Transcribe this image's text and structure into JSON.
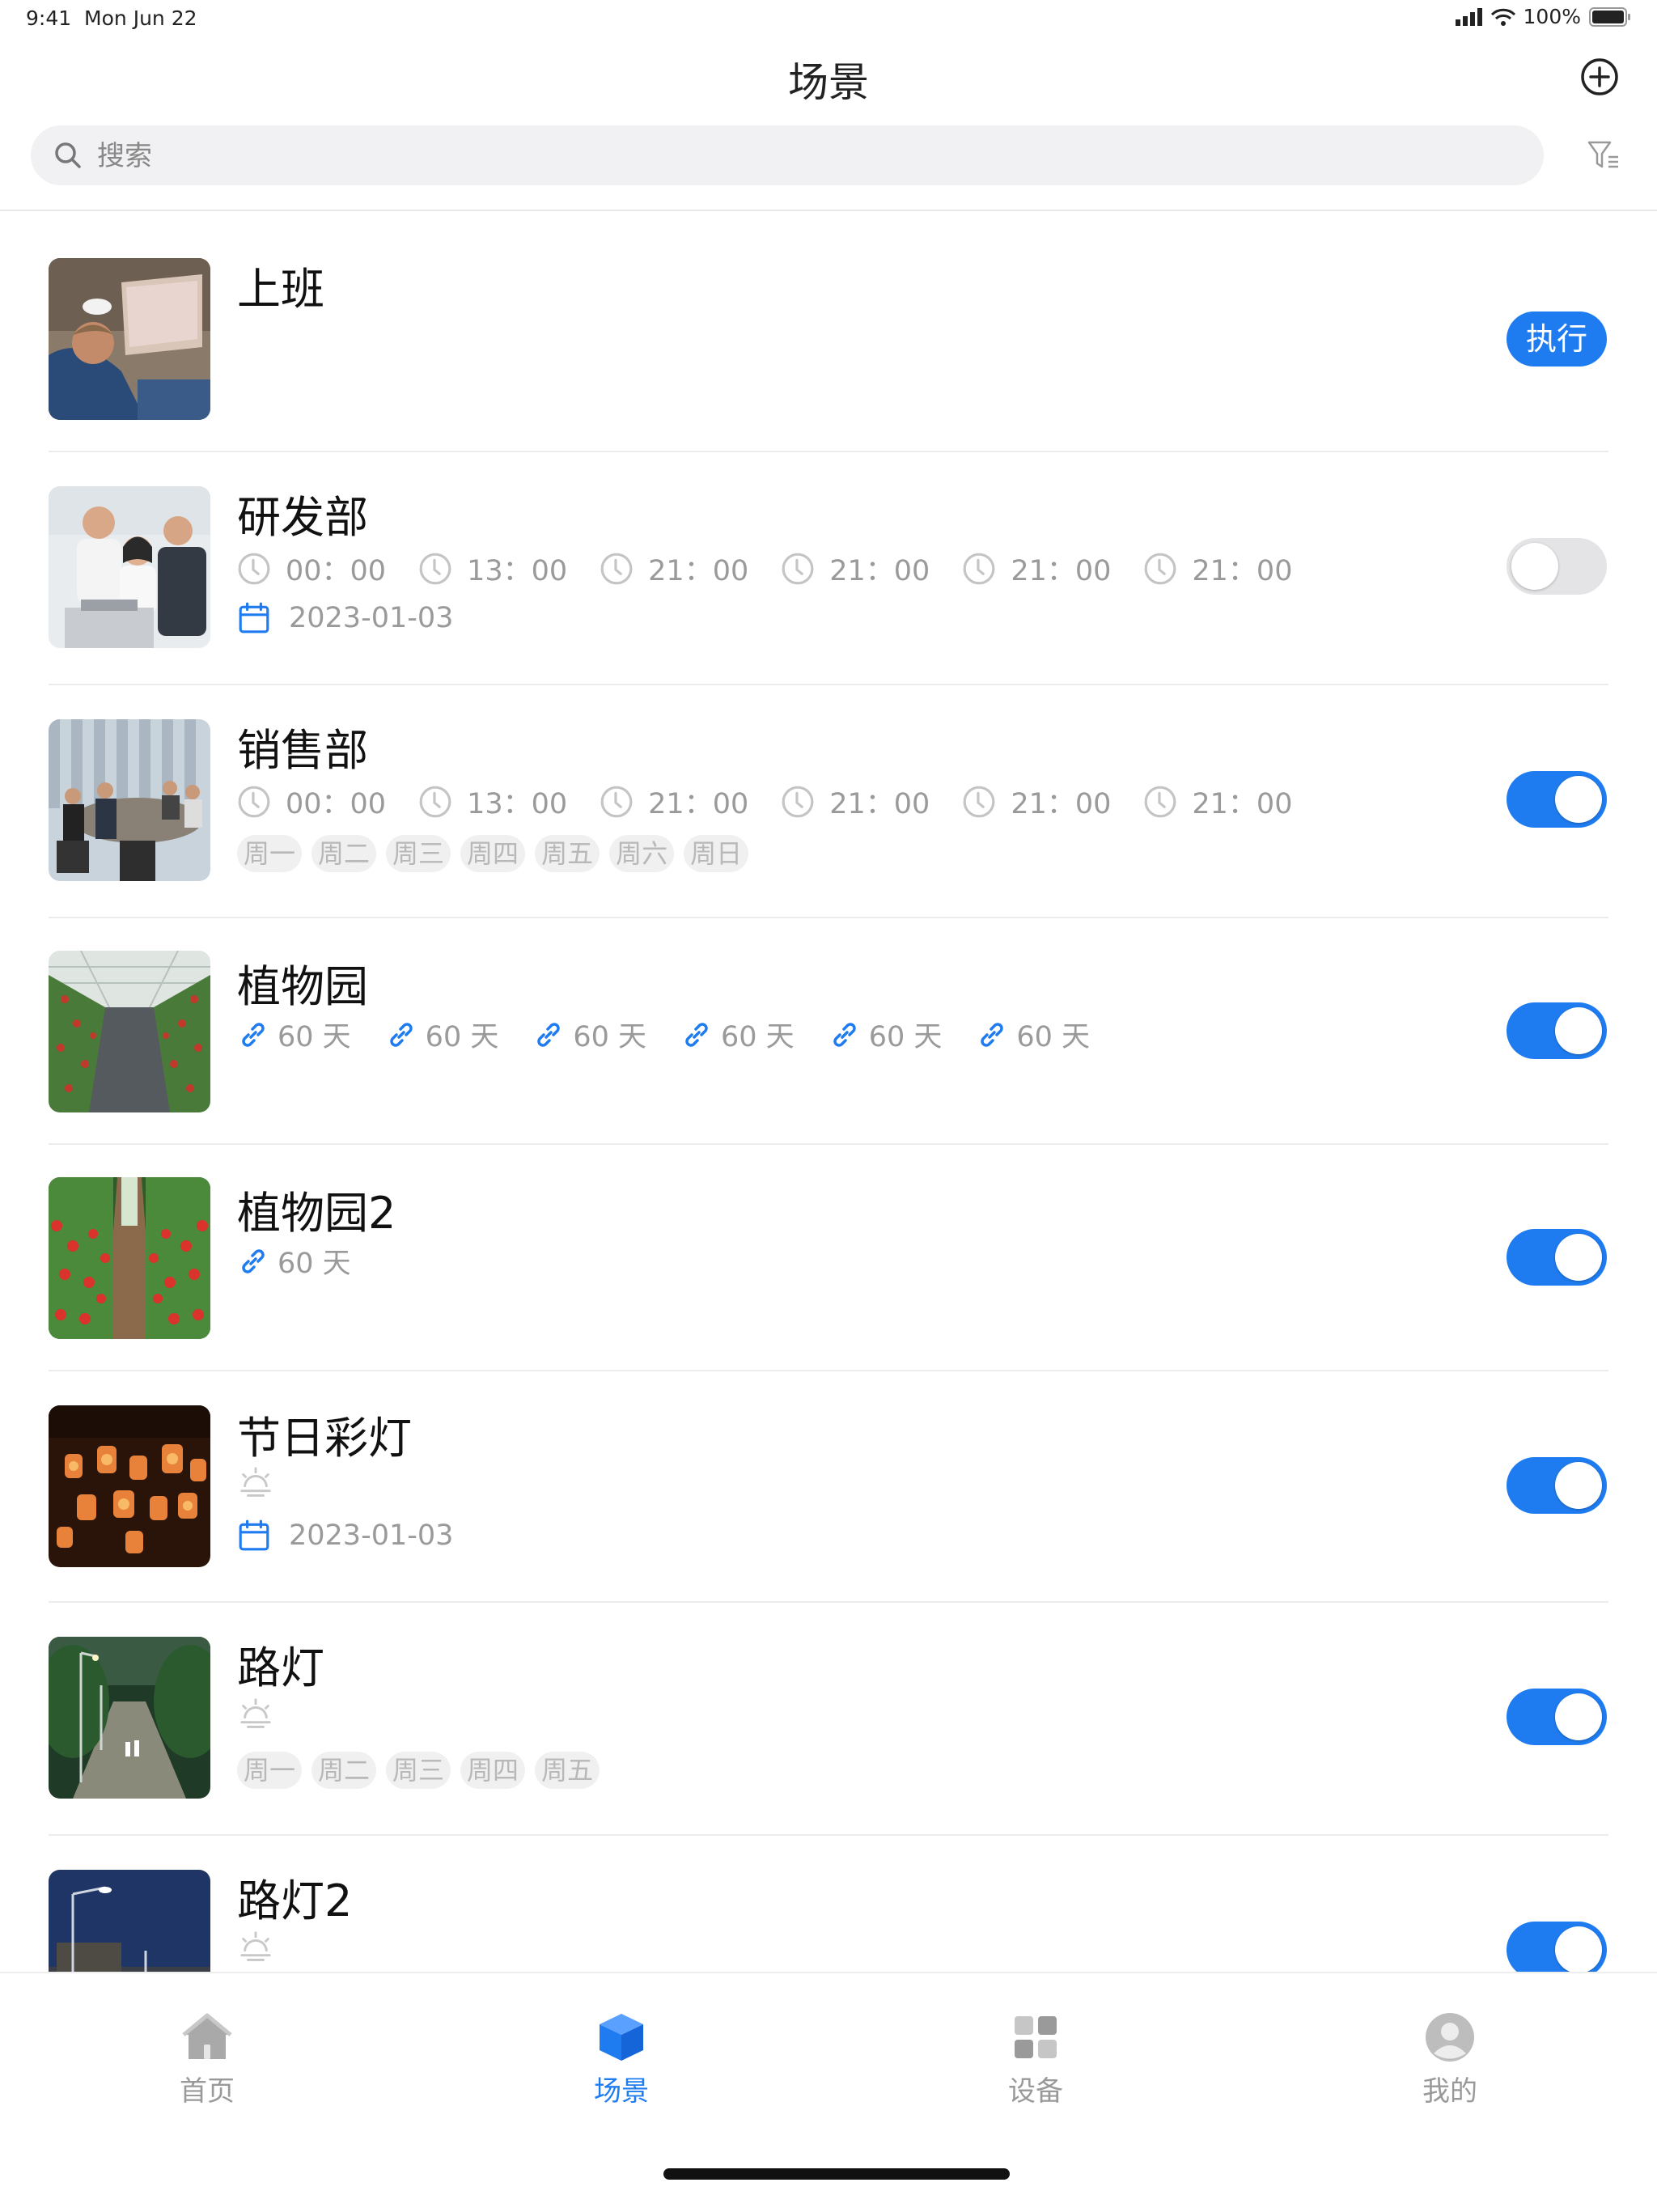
{
  "status_bar": {
    "time": "9:41",
    "date": "Mon Jun 22",
    "battery": "100%"
  },
  "nav": {
    "title": "场景"
  },
  "search": {
    "placeholder": "搜索"
  },
  "scenes": [
    {
      "title": "上班",
      "image": "office-laptop",
      "action_label": "执行"
    },
    {
      "title": "研发部",
      "image": "team-meeting",
      "times": [
        "00：00",
        "13：00",
        "21：00",
        "21：00",
        "21：00",
        "21：00"
      ],
      "date": "2023-01-03",
      "enabled": false
    },
    {
      "title": "销售部",
      "image": "conference-room",
      "times": [
        "00：00",
        "13：00",
        "21：00",
        "21：00",
        "21：00",
        "21：00"
      ],
      "weekdays": [
        "周一",
        "周二",
        "周三",
        "周四",
        "周五",
        "周六",
        "周日"
      ],
      "enabled": true
    },
    {
      "title": "植物园",
      "image": "greenhouse",
      "links": [
        "60 天",
        "60 天",
        "60 天",
        "60 天",
        "60 天",
        "60 天"
      ],
      "enabled": true
    },
    {
      "title": "植物园2",
      "image": "tomato-greenhouse",
      "links": [
        "60 天"
      ],
      "enabled": true
    },
    {
      "title": "节日彩灯",
      "image": "lanterns",
      "icon": "sunrise-icon",
      "date": "2023-01-03",
      "enabled": true
    },
    {
      "title": "路灯",
      "image": "street-lamps",
      "icon": "sunrise-icon",
      "weekdays": [
        "周一",
        "周二",
        "周三",
        "周四",
        "周五"
      ],
      "enabled": true
    },
    {
      "title": "路灯2",
      "image": "street-lamp-night",
      "icon": "sunrise-icon",
      "enabled": true
    }
  ],
  "tabbar": {
    "tabs": [
      {
        "label": "首页",
        "icon": "home-icon"
      },
      {
        "label": "场景",
        "icon": "cube-icon",
        "active": true
      },
      {
        "label": "设备",
        "icon": "grid-icon"
      },
      {
        "label": "我的",
        "icon": "user-icon"
      }
    ]
  },
  "colors": {
    "accent": "#1f7cf0",
    "muted_text": "#9a9a9a",
    "chip_bg": "#f0f0f0",
    "toggle_off": "#e4e4e6"
  }
}
